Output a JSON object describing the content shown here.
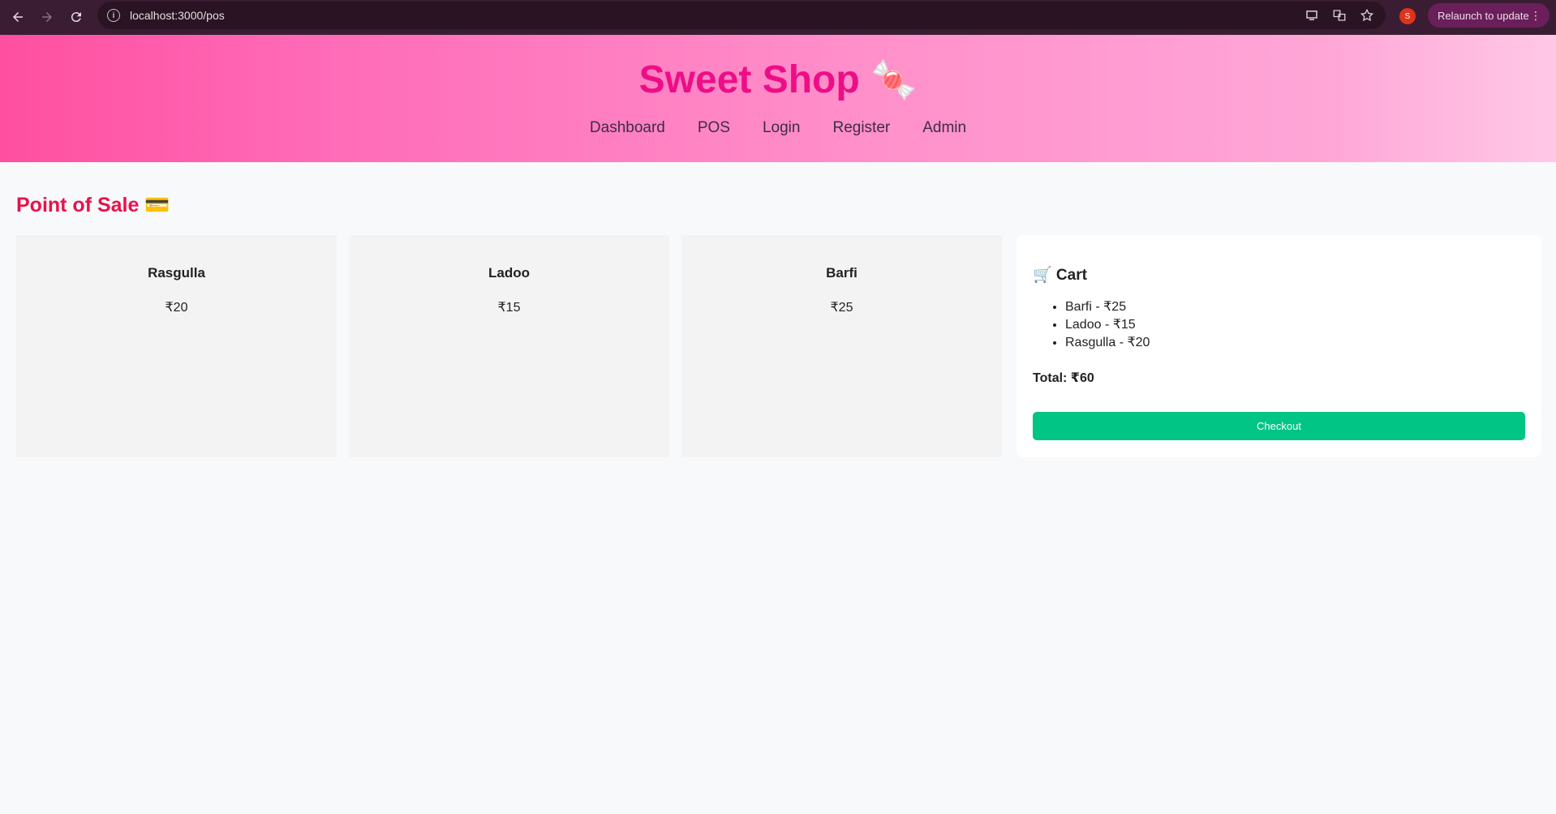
{
  "browser": {
    "url": "localhost:3000/pos",
    "profile_initial": "S",
    "relaunch_label": "Relaunch to update"
  },
  "header": {
    "title": "Sweet Shop",
    "title_emoji": "🍬",
    "nav": [
      "Dashboard",
      "POS",
      "Login",
      "Register",
      "Admin"
    ]
  },
  "page": {
    "title": "Point of Sale 💳"
  },
  "products": [
    {
      "name": "Rasgulla",
      "price": "₹20"
    },
    {
      "name": "Ladoo",
      "price": "₹15"
    },
    {
      "name": "Barfi",
      "price": "₹25"
    }
  ],
  "cart": {
    "title": "🛒 Cart",
    "items": [
      "Barfi - ₹25",
      "Ladoo - ₹15",
      "Rasgulla - ₹20"
    ],
    "total": "Total: ₹60",
    "checkout_label": "Checkout"
  },
  "colors": {
    "title_pink": "#ee0d87",
    "heading_red": "#e8124b",
    "checkout_green": "#00c585"
  }
}
